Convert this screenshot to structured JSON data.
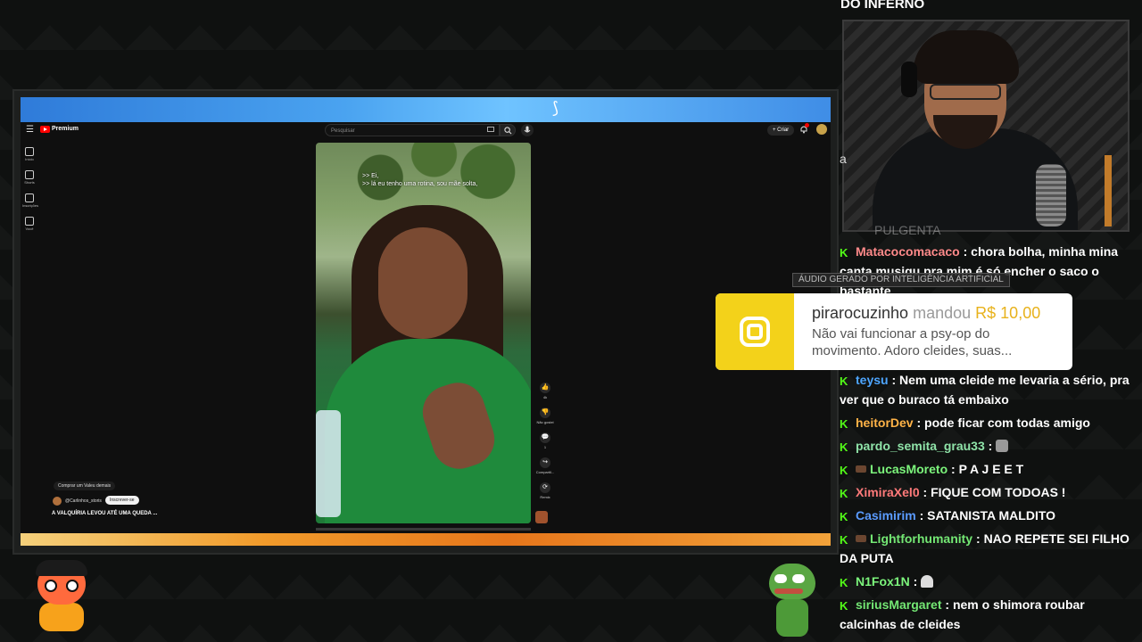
{
  "overlay": {
    "top_fragment": "DO INFERNO",
    "left_sliver": "a",
    "hidden_behind": "PULGENTA"
  },
  "youtube": {
    "brand": "Premium",
    "search_placeholder": "Pesquisar",
    "create_label": "+ Criar",
    "sidebar": [
      {
        "label": "Início"
      },
      {
        "label": "Shorts"
      },
      {
        "label": "Inscrições"
      },
      {
        "label": "Você"
      }
    ],
    "captions": [
      ">> Ei,",
      ">> lá eu tenho uma rotina, sou mãe solta,"
    ],
    "actions": [
      {
        "icon": "like-icon",
        "glyph": "👍",
        "label": "4k"
      },
      {
        "icon": "dislike-icon",
        "glyph": "👎",
        "label": "Não gostei"
      },
      {
        "icon": "comment-icon",
        "glyph": "💬",
        "label": "1"
      },
      {
        "icon": "share-icon",
        "glyph": "↪",
        "label": "Compartil..."
      },
      {
        "icon": "remix-icon",
        "glyph": "⟳",
        "label": "Remix"
      }
    ],
    "buy_label": "Comprar um Valeu demais",
    "channel_name": "@Carlinhos_storis",
    "subscribe_label": "Inscrever-se",
    "video_title": "A VALQUÍRIA LEVOU ATÉ UMA QUEDA ..."
  },
  "donation": {
    "ai_label": "ÁUDIO GERADO POR INTELIGÊNCIA ARTIFICIAL",
    "name": "pirarocuzinho",
    "verb": "mandou",
    "amount": "R$ 10,00",
    "message": "Não vai funcionar a psy-op do movimento. Adoro cleides, suas...",
    "accent_color": "#f3d21a"
  },
  "chat": {
    "badge_color": "#53fc18",
    "messages": [
      {
        "user": "Matacocomacaco",
        "color": "#ff8a8a",
        "sub": false,
        "text": "chora bolha, minha mina canta musiqu pra mim é só encher o saco o bastante"
      },
      {
        "user": "teysu",
        "color": "#4ea6ff",
        "sub": false,
        "text": "Nem uma cleide me levaria a sério, pra ver que o buraco tá embaixo"
      },
      {
        "user": "heitorDev",
        "color": "#ffb347",
        "sub": false,
        "text": "pode ficar com todas amigo"
      },
      {
        "user": "pardo_semita_grau33",
        "color": "#8fe3a8",
        "sub": false,
        "text": "",
        "emote": "emote-icon"
      },
      {
        "user": "LucasMoreto",
        "color": "#7cf57c",
        "sub": true,
        "text": "P A J E E T"
      },
      {
        "user": "XimiraXel0",
        "color": "#ff7a7a",
        "sub": false,
        "text": "FIQUE COM TODOAS !"
      },
      {
        "user": "Casimirim",
        "color": "#5a9bff",
        "sub": false,
        "text": "SATANISTA MALDITO"
      },
      {
        "user": "Lightforhumanity",
        "color": "#74e874",
        "sub": true,
        "text": "NAO REPETE SEI FILHO DA PUTA"
      },
      {
        "user": "N1Fox1N",
        "color": "#7cf57c",
        "sub": false,
        "text": "",
        "emote": "ghost-emote-icon"
      },
      {
        "user": "siriusMargaret",
        "color": "#74e874",
        "sub": false,
        "text": "nem o shimora roubar calcinhas de cleides"
      }
    ]
  }
}
